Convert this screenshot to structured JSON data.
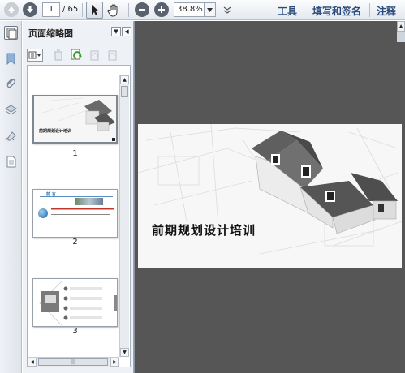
{
  "toolbar": {
    "page_current": "1",
    "page_total": "/ 65",
    "zoom": "38.8%",
    "menu": [
      "工具",
      "填写和签名",
      "注释"
    ]
  },
  "panel": {
    "title": "页面缩略图",
    "thumbnails": [
      {
        "number": "1",
        "title": "前期规划设计培训"
      },
      {
        "number": "2",
        "title": "前 言"
      },
      {
        "number": "3",
        "title": ""
      }
    ]
  },
  "document": {
    "slide_title": "前期规划设计培训"
  }
}
